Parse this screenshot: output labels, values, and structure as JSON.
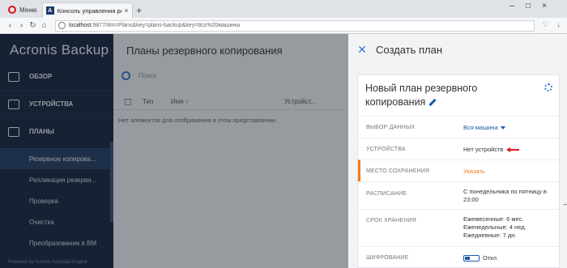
{
  "browser": {
    "menu_label": "Меню",
    "tab_title": "Консоль управления резерв",
    "new_tab": "+",
    "url_host": "localhost",
    "url_rest": ":9877/#m=Plans&key=plans-backup&key=8cs%20машины"
  },
  "sidebar": {
    "brand_1": "Acronis",
    "brand_2": "Backup",
    "groups": [
      {
        "label": "ОБЗОР"
      },
      {
        "label": "УСТРОЙСТВА"
      },
      {
        "label": "ПЛАНЫ"
      }
    ],
    "items": [
      {
        "label": "Резервное копирова..."
      },
      {
        "label": "Репликация резервн..."
      },
      {
        "label": "Проверка"
      },
      {
        "label": "Очистка"
      },
      {
        "label": "Преобразование в ВМ"
      }
    ],
    "powered": "Powered by Acronis AnyData Engine"
  },
  "main": {
    "title": "Планы резервного копирования",
    "search_placeholder": "Поиск",
    "col_type": "Тип",
    "col_name": "Имя ↑",
    "col_devices": "Устройст...",
    "empty_message": "Нет элементов для отображения в этом представлении."
  },
  "panel": {
    "title": "Создать план",
    "plan_name": "Новый план резервного копирования",
    "rows": [
      {
        "label": "ВЫБОР ДАННЫХ",
        "value": "Вся машина"
      },
      {
        "label": "УСТРОЙСТВА",
        "value": "Нет устройств"
      },
      {
        "label": "МЕСТО СОХРАНЕНИЯ",
        "value": "Указать"
      },
      {
        "label": "РАСПИСАНИЕ",
        "value": "С понедельника по пятницу в 23:00"
      },
      {
        "label": "СРОК ХРАНЕНИЯ",
        "value_lines": [
          "Ежемесячные: 6 мес.",
          "Еженедельные: 4 нед.",
          "Ежедневные: 7 дн."
        ]
      },
      {
        "label": "ШИФРОВАНИЕ",
        "value": "Откл."
      }
    ]
  },
  "colors": {
    "sidebar_bg": "#14243e",
    "accent_blue": "#1a5aa8",
    "accent_orange": "#f07a1e",
    "annotation_red": "#e01818"
  }
}
